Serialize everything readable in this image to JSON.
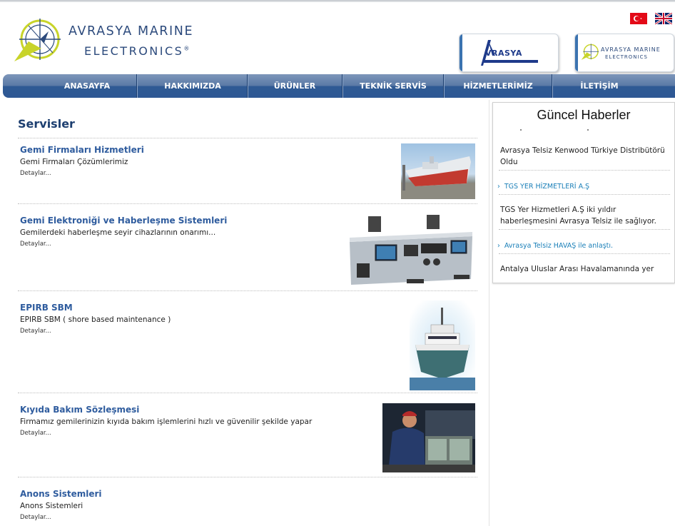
{
  "brand": {
    "line1": "AVRASYA MARINE",
    "line2": "ELECTRONICS",
    "reg": "®"
  },
  "partners": {
    "avrasya_text": "VRASYA",
    "marine_line1": "AVRASYA MARINE",
    "marine_line2": "ELECTRONICS"
  },
  "nav": [
    "ANASAYFA",
    "HAKKIMIZDA",
    "ÜRÜNLER",
    "TEKNİK SERVİS",
    "HİZMETLERİMİZ",
    "İLETİŞİM"
  ],
  "main": {
    "title": "Servisler",
    "services": [
      {
        "name": "Gemi Firmaları Hizmetleri",
        "desc": "Gemi Firmaları Çözümlerimiz",
        "more": "Detaylar..."
      },
      {
        "name": "Gemi Elektroniği ve Haberleşme Sistemleri",
        "desc": "Gemilerdeki haberleşme seyir cihazlarının onarımı...",
        "more": "Detaylar..."
      },
      {
        "name": "EPIRB SBM",
        "desc": "EPIRB SBM ( shore based maintenance )",
        "more": "Detaylar..."
      },
      {
        "name": "Kıyıda Bakım Sözleşmesi",
        "desc": "Firmamız gemilerinizin kıyıda bakım işlemlerini hızlı ve güvenilir şekilde yapar",
        "more": "Detaylar..."
      },
      {
        "name": "Anons Sistemleri",
        "desc": "Anons Sistemleri",
        "more": "Detaylar..."
      }
    ]
  },
  "news": {
    "title": "Güncel Haberler",
    "item1_text": "Avrasya Telsiz Kenwood Türkiye Distribütörü Oldu",
    "item2_link": "TGS YER HİZMETLERİ A.Ş",
    "item2_text": "TGS Yer Hizmetleri A.Ş iki yıldır haberleşmesini Avrasya Telsiz ile sağlıyor.",
    "item3_link": "Avrasya Telsiz HAVAŞ ile anlaştı.",
    "item3_text": "Antalya Uluslar Arası Havalamanında yer"
  }
}
